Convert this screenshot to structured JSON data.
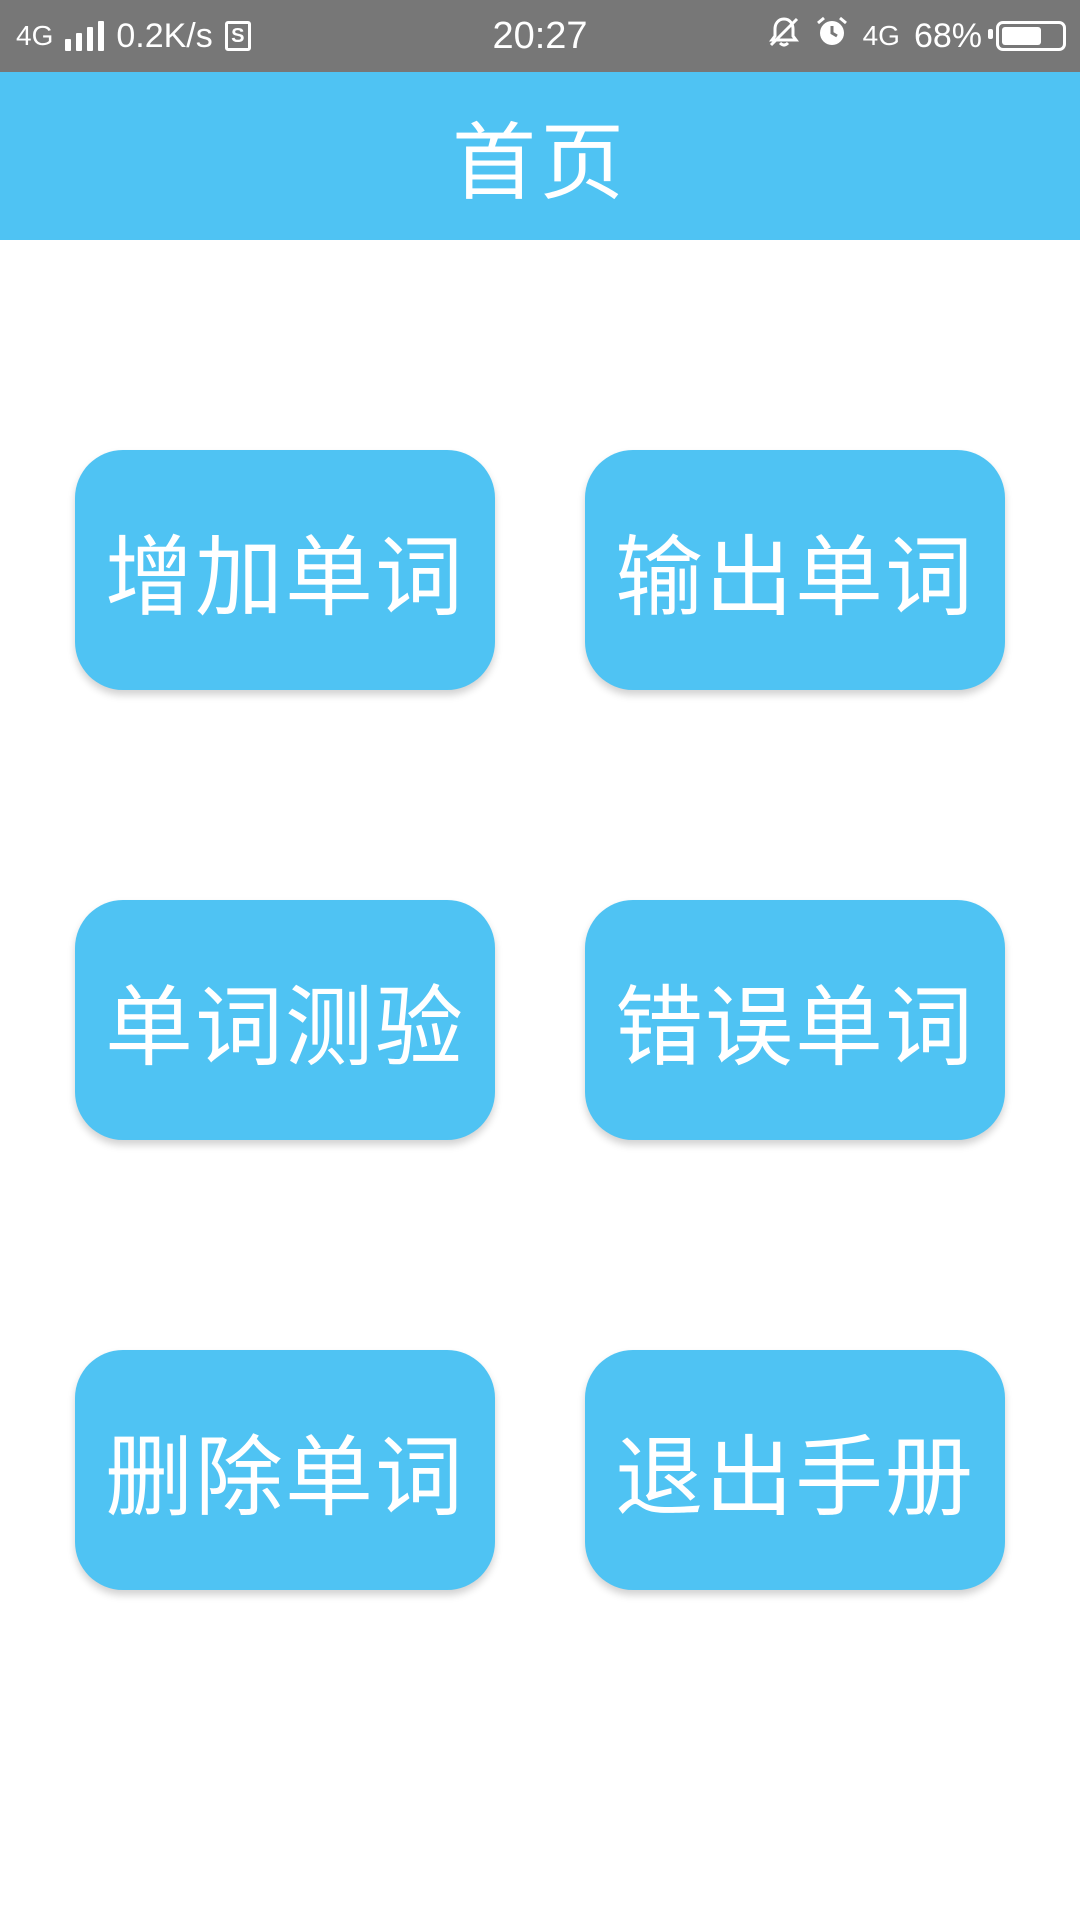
{
  "status_bar": {
    "network_left": "4G",
    "speed": "0.2K/s",
    "sim_label": "S",
    "time": "20:27",
    "network_right": "4G",
    "battery_percent": "68%",
    "battery_level": 0.68,
    "icons": [
      "signal-icon",
      "sim-icon",
      "mute-icon",
      "alarm-icon",
      "battery-icon"
    ]
  },
  "app_bar": {
    "title": "首页"
  },
  "menu": {
    "buttons": [
      {
        "label": "增加单词"
      },
      {
        "label": "输出单词"
      },
      {
        "label": "单词测验"
      },
      {
        "label": "错误单词"
      },
      {
        "label": "删除单词"
      },
      {
        "label": "退出手册"
      }
    ]
  },
  "colors": {
    "accent": "#4fc3f3",
    "status_bar": "#777777",
    "text_on_accent": "#ffffff",
    "background": "#ffffff"
  }
}
